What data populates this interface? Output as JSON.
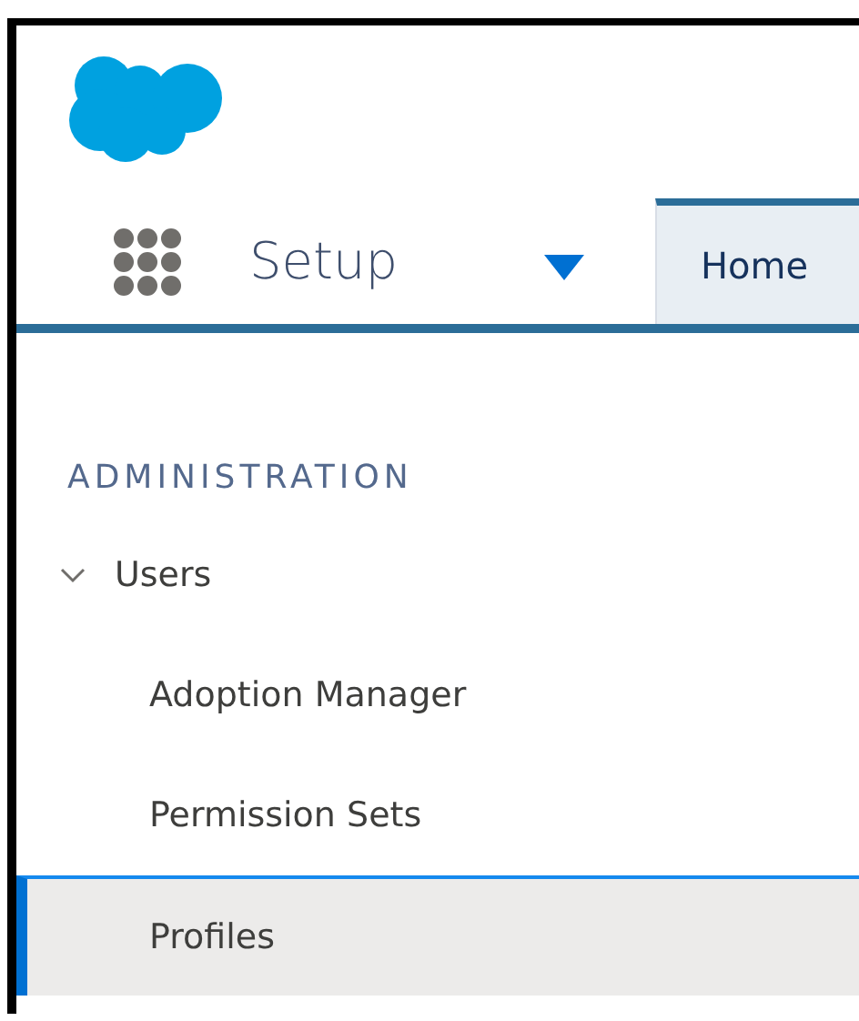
{
  "header": {
    "app_name": "Setup"
  },
  "tabs": [
    {
      "label": "Home",
      "selected": true
    }
  ],
  "sidebar": {
    "section": "ADMINISTRATION",
    "items": [
      {
        "label": "Users",
        "expanded": true,
        "selected": false,
        "children": [
          {
            "label": "Adoption Manager",
            "selected": false
          },
          {
            "label": "Permission Sets",
            "selected": false
          },
          {
            "label": "Profiles",
            "selected": true
          }
        ]
      }
    ]
  }
}
